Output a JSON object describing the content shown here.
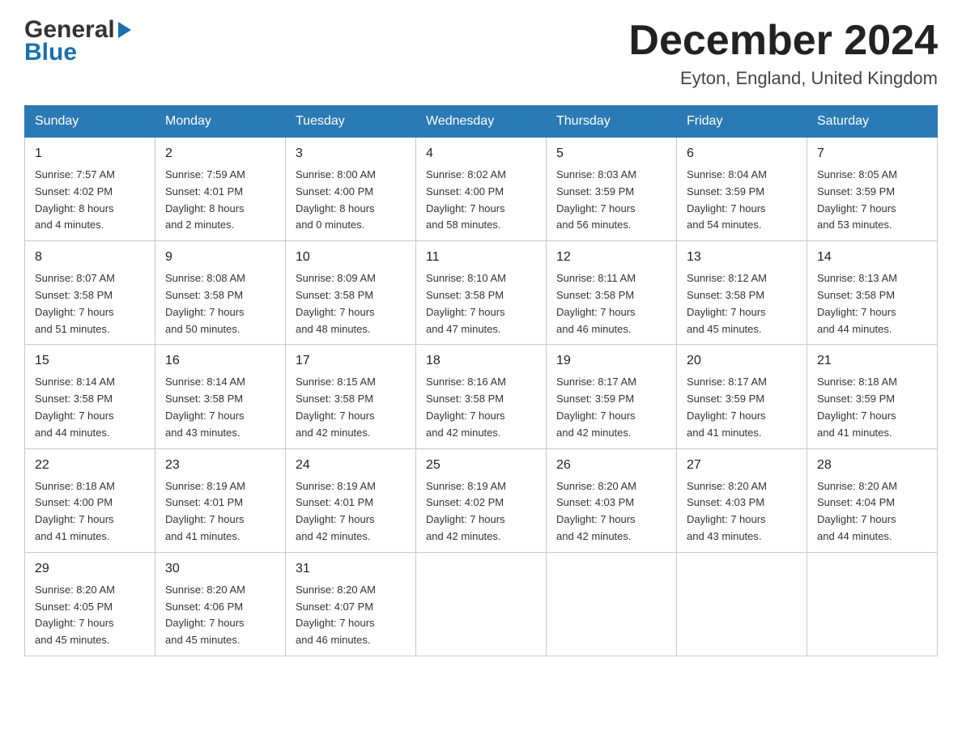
{
  "header": {
    "logo_general": "General",
    "logo_blue": "Blue",
    "month_year": "December 2024",
    "location": "Eyton, England, United Kingdom"
  },
  "weekdays": [
    "Sunday",
    "Monday",
    "Tuesday",
    "Wednesday",
    "Thursday",
    "Friday",
    "Saturday"
  ],
  "weeks": [
    [
      {
        "day": "1",
        "sunrise": "7:57 AM",
        "sunset": "4:02 PM",
        "daylight": "8 hours and 4 minutes."
      },
      {
        "day": "2",
        "sunrise": "7:59 AM",
        "sunset": "4:01 PM",
        "daylight": "8 hours and 2 minutes."
      },
      {
        "day": "3",
        "sunrise": "8:00 AM",
        "sunset": "4:00 PM",
        "daylight": "8 hours and 0 minutes."
      },
      {
        "day": "4",
        "sunrise": "8:02 AM",
        "sunset": "4:00 PM",
        "daylight": "7 hours and 58 minutes."
      },
      {
        "day": "5",
        "sunrise": "8:03 AM",
        "sunset": "3:59 PM",
        "daylight": "7 hours and 56 minutes."
      },
      {
        "day": "6",
        "sunrise": "8:04 AM",
        "sunset": "3:59 PM",
        "daylight": "7 hours and 54 minutes."
      },
      {
        "day": "7",
        "sunrise": "8:05 AM",
        "sunset": "3:59 PM",
        "daylight": "7 hours and 53 minutes."
      }
    ],
    [
      {
        "day": "8",
        "sunrise": "8:07 AM",
        "sunset": "3:58 PM",
        "daylight": "7 hours and 51 minutes."
      },
      {
        "day": "9",
        "sunrise": "8:08 AM",
        "sunset": "3:58 PM",
        "daylight": "7 hours and 50 minutes."
      },
      {
        "day": "10",
        "sunrise": "8:09 AM",
        "sunset": "3:58 PM",
        "daylight": "7 hours and 48 minutes."
      },
      {
        "day": "11",
        "sunrise": "8:10 AM",
        "sunset": "3:58 PM",
        "daylight": "7 hours and 47 minutes."
      },
      {
        "day": "12",
        "sunrise": "8:11 AM",
        "sunset": "3:58 PM",
        "daylight": "7 hours and 46 minutes."
      },
      {
        "day": "13",
        "sunrise": "8:12 AM",
        "sunset": "3:58 PM",
        "daylight": "7 hours and 45 minutes."
      },
      {
        "day": "14",
        "sunrise": "8:13 AM",
        "sunset": "3:58 PM",
        "daylight": "7 hours and 44 minutes."
      }
    ],
    [
      {
        "day": "15",
        "sunrise": "8:14 AM",
        "sunset": "3:58 PM",
        "daylight": "7 hours and 44 minutes."
      },
      {
        "day": "16",
        "sunrise": "8:14 AM",
        "sunset": "3:58 PM",
        "daylight": "7 hours and 43 minutes."
      },
      {
        "day": "17",
        "sunrise": "8:15 AM",
        "sunset": "3:58 PM",
        "daylight": "7 hours and 42 minutes."
      },
      {
        "day": "18",
        "sunrise": "8:16 AM",
        "sunset": "3:58 PM",
        "daylight": "7 hours and 42 minutes."
      },
      {
        "day": "19",
        "sunrise": "8:17 AM",
        "sunset": "3:59 PM",
        "daylight": "7 hours and 42 minutes."
      },
      {
        "day": "20",
        "sunrise": "8:17 AM",
        "sunset": "3:59 PM",
        "daylight": "7 hours and 41 minutes."
      },
      {
        "day": "21",
        "sunrise": "8:18 AM",
        "sunset": "3:59 PM",
        "daylight": "7 hours and 41 minutes."
      }
    ],
    [
      {
        "day": "22",
        "sunrise": "8:18 AM",
        "sunset": "4:00 PM",
        "daylight": "7 hours and 41 minutes."
      },
      {
        "day": "23",
        "sunrise": "8:19 AM",
        "sunset": "4:01 PM",
        "daylight": "7 hours and 41 minutes."
      },
      {
        "day": "24",
        "sunrise": "8:19 AM",
        "sunset": "4:01 PM",
        "daylight": "7 hours and 42 minutes."
      },
      {
        "day": "25",
        "sunrise": "8:19 AM",
        "sunset": "4:02 PM",
        "daylight": "7 hours and 42 minutes."
      },
      {
        "day": "26",
        "sunrise": "8:20 AM",
        "sunset": "4:03 PM",
        "daylight": "7 hours and 42 minutes."
      },
      {
        "day": "27",
        "sunrise": "8:20 AM",
        "sunset": "4:03 PM",
        "daylight": "7 hours and 43 minutes."
      },
      {
        "day": "28",
        "sunrise": "8:20 AM",
        "sunset": "4:04 PM",
        "daylight": "7 hours and 44 minutes."
      }
    ],
    [
      {
        "day": "29",
        "sunrise": "8:20 AM",
        "sunset": "4:05 PM",
        "daylight": "7 hours and 45 minutes."
      },
      {
        "day": "30",
        "sunrise": "8:20 AM",
        "sunset": "4:06 PM",
        "daylight": "7 hours and 45 minutes."
      },
      {
        "day": "31",
        "sunrise": "8:20 AM",
        "sunset": "4:07 PM",
        "daylight": "7 hours and 46 minutes."
      },
      null,
      null,
      null,
      null
    ]
  ],
  "labels": {
    "sunrise": "Sunrise:",
    "sunset": "Sunset:",
    "daylight": "Daylight:"
  }
}
